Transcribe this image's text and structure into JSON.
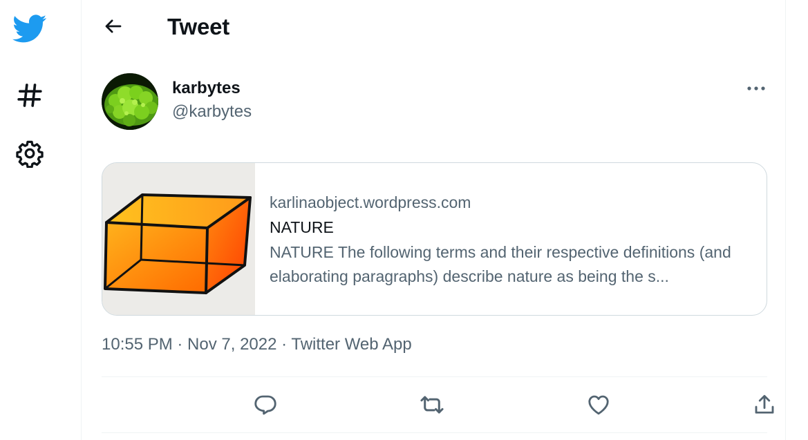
{
  "colors": {
    "brand": "#1d9bf0",
    "text_primary": "#0f1419",
    "text_secondary": "#536471",
    "border": "#cfd9de"
  },
  "nav": {
    "items": [
      {
        "icon": "twitter-logo-icon"
      },
      {
        "icon": "hashtag-icon"
      },
      {
        "icon": "gear-icon"
      }
    ]
  },
  "header": {
    "back_icon": "arrow-left-icon",
    "title": "Tweet"
  },
  "tweet": {
    "author": {
      "name": "karbytes",
      "handle": "@karbytes"
    },
    "more_icon": "ellipsis-icon",
    "link_card": {
      "domain": "karlinaobject.wordpress.com",
      "title": "NATURE",
      "description": "NATURE The following terms and their respective definitions (and elaborating paragraphs) describe nature as being the s..."
    },
    "meta": "10:55 PM · Nov 7, 2022 · Twitter Web App",
    "actions": [
      {
        "icon": "reply-icon"
      },
      {
        "icon": "retweet-icon"
      },
      {
        "icon": "like-icon"
      },
      {
        "icon": "share-icon"
      }
    ]
  }
}
